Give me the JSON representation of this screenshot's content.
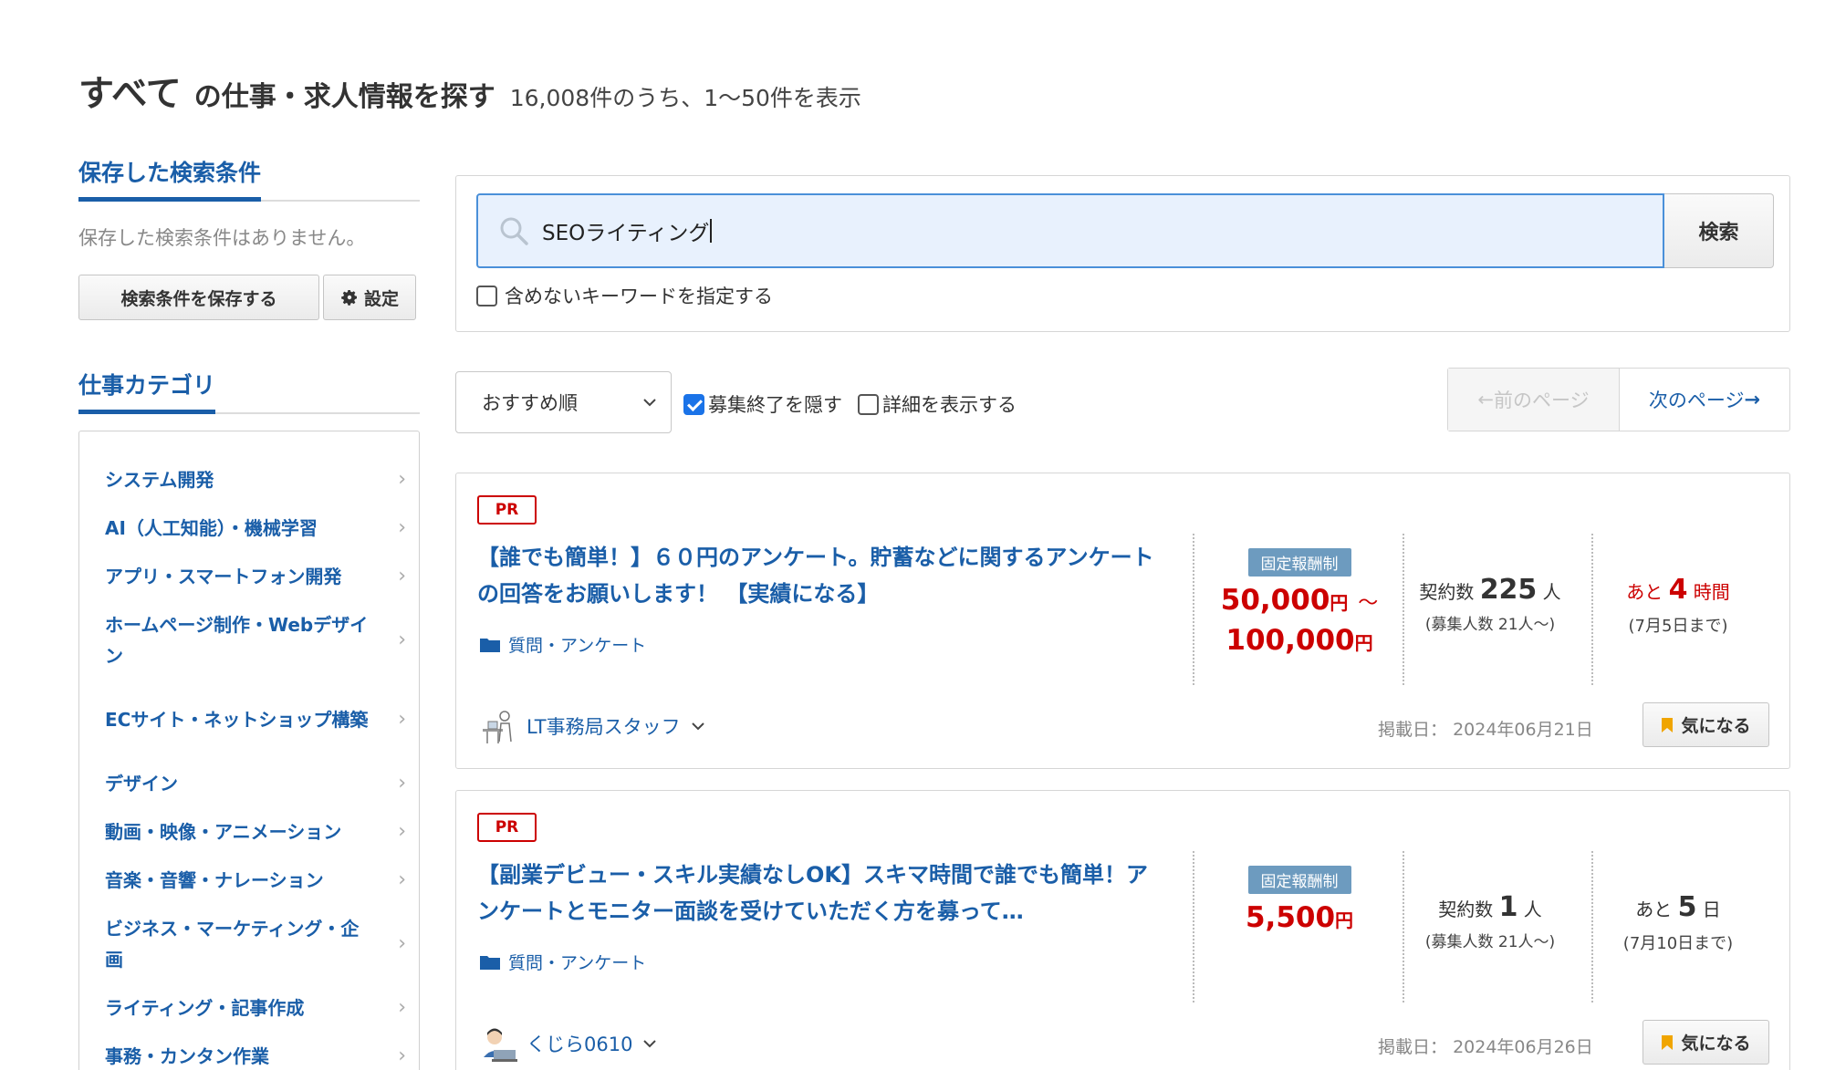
{
  "heading": {
    "main": "すべて",
    "sub": "の仕事・求人情報を探す",
    "count": "16,008件のうち、1〜50件を表示"
  },
  "sidebar": {
    "saved_title": "保存した検索条件",
    "saved_empty": "保存した検索条件はありません。",
    "save_button": "検索条件を保存する",
    "settings_button": "設定",
    "category_title": "仕事カテゴリ",
    "categories": [
      {
        "label": "システム開発"
      },
      {
        "label": "AI（人工知能）・機械学習"
      },
      {
        "label": "アプリ・スマートフォン開発"
      },
      {
        "label": "ホームページ制作・Webデザイン"
      },
      {
        "label": "ECサイト・ネットショップ構築"
      },
      {
        "label": "デザイン"
      },
      {
        "label": "動画・映像・アニメーション"
      },
      {
        "label": "音楽・音響・ナレーション"
      },
      {
        "label": "ビジネス・マーケティング・企画"
      },
      {
        "label": "ライティング・記事作成"
      },
      {
        "label": "事務・カンタン作業"
      }
    ]
  },
  "search": {
    "value": "SEOライティング",
    "button": "検索",
    "exclude_label": "含めないキーワードを指定する",
    "exclude_checked": false
  },
  "sort": {
    "selected": "おすすめ順",
    "hide_closed_label": "募集終了を隠す",
    "hide_closed_checked": true,
    "show_details_label": "詳細を表示する",
    "show_details_checked": false,
    "prev_page": "前のページ",
    "next_page": "次のページ"
  },
  "jobs": [
    {
      "pr": "PR",
      "title": "【誰でも簡単！】６０円のアンケート。貯蓄などに関するアンケートの回答をお願いします！ 【実績になる】",
      "category": "質問・アンケート",
      "pay_type": "固定報酬制",
      "price_min": "50,000",
      "price_unit": "円",
      "price_tilde": "〜",
      "price_max": "100,000",
      "contract_label": "契約数",
      "contract_count": "225",
      "contract_unit": "人",
      "recruit": "(募集人数 21人〜)",
      "deadline_prefix": "あと",
      "deadline_num": "4",
      "deadline_unit": "時間",
      "deadline_date": "(7月5日まで)",
      "deadline_urgent": true,
      "client": "LT事務局スタッフ",
      "posted_label": "掲載日：",
      "posted_date": "2024年06月21日",
      "fav": "気になる"
    },
    {
      "pr": "PR",
      "title": "【副業デビュー・スキル実績なしOK】スキマ時間で誰でも簡単！アンケートとモニター面談を受けていただく方を募って…",
      "category": "質問・アンケート",
      "pay_type": "固定報酬制",
      "price_min": "5,500",
      "price_unit": "円",
      "contract_label": "契約数",
      "contract_count": "1",
      "contract_unit": "人",
      "recruit": "(募集人数 21人〜)",
      "deadline_prefix": "あと",
      "deadline_num": "5",
      "deadline_unit": "日",
      "deadline_date": "(7月10日まで)",
      "deadline_urgent": false,
      "client": "くじら0610",
      "posted_label": "掲載日：",
      "posted_date": "2024年06月26日",
      "fav": "気になる"
    }
  ],
  "colors": {
    "link_blue": "#1a5ea8",
    "price_red": "#cc0000",
    "badge_blue": "#6d9bbf",
    "search_bg": "#e8f1fd",
    "bookmark_orange": "#f0a500"
  }
}
